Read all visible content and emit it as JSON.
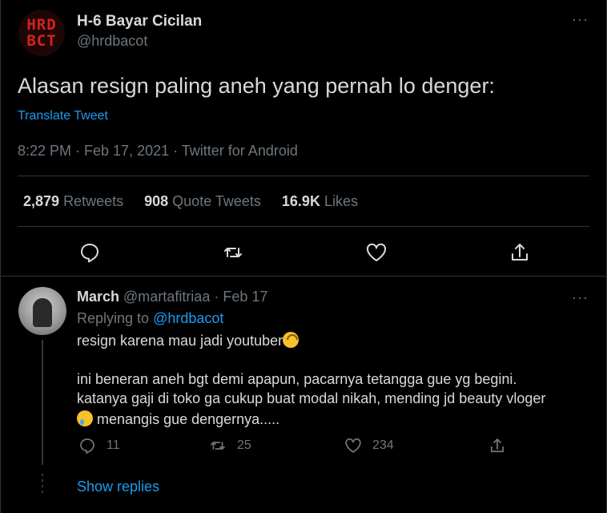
{
  "tweet": {
    "author_name": "H-6 Bayar Cicilan",
    "author_handle": "@hrdbacot",
    "avatar_text_line1": "HRD",
    "avatar_text_line2": "BCT",
    "text": "Alasan resign paling aneh yang pernah lo denger:",
    "translate_label": "Translate Tweet",
    "meta": "8:22 PM · Feb 17, 2021 · Twitter for Android",
    "stats": {
      "retweets_count": "2,879",
      "retweets_label": "Retweets",
      "quotes_count": "908",
      "quotes_label": "Quote Tweets",
      "likes_count": "16.9K",
      "likes_label": "Likes"
    },
    "more_label": "···",
    "actions": [
      "reply-icon",
      "retweet-icon",
      "like-icon",
      "share-icon"
    ]
  },
  "reply": {
    "author_name": "March",
    "author_handle": "@martafitriaa",
    "date": "· Feb 17",
    "replying_prefix": "Replying to",
    "replying_to": "@hrdbacot",
    "line1": "resign karena mau jadi youtuber",
    "line2": "ini beneran aneh bgt demi apapun, pacarnya tetangga gue yg begini.",
    "line3": "katanya gaji di toko ga cukup buat modal nikah, mending jd beauty vloger",
    "line4": "menangis gue dengernya.....",
    "reply_count": "11",
    "retweet_count": "25",
    "like_count": "234",
    "more_label": "···",
    "show_replies": "Show replies"
  },
  "colors": {
    "background": "#000000",
    "accent": "#1d9bf0",
    "text_primary": "#d9d9d9",
    "text_secondary": "#6e767d",
    "divider": "#2f3336"
  }
}
